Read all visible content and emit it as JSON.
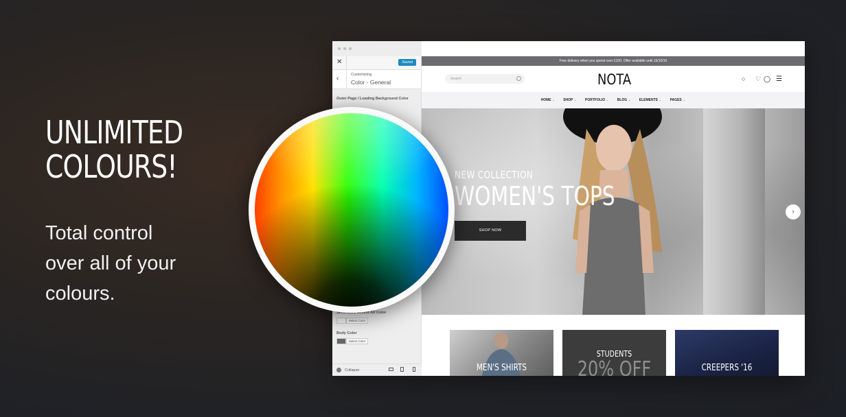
{
  "headline": {
    "line1": "UNLIMITED",
    "line2": "COLOURS!"
  },
  "subtext": {
    "line1": "Total control",
    "line2": "over all of your",
    "line3": "colours."
  },
  "customizer": {
    "close_icon": "close-icon",
    "saved_label": "Saved",
    "back_icon": "chevron-left-icon",
    "section_sup": "Customizing",
    "section_title": "Color - General",
    "options": [
      {
        "label": "Outer Page / Loading Background Color"
      },
      {
        "label": "Secondary Accent Alt Color",
        "button": "Select Color",
        "swatch": "#f2f2f2"
      },
      {
        "label": "Body Color",
        "button": "Select Color",
        "swatch": "#666666"
      }
    ],
    "collapse_label": "Collapse",
    "device_icons": [
      "desktop-icon",
      "tablet-icon",
      "mobile-icon"
    ]
  },
  "site": {
    "promo": "Free delivery when you spend over £100. Offer available until 16/10/16",
    "search_placeholder": "Search",
    "logo": "NOTA",
    "nav": [
      "HOME",
      "SHOP",
      "PORTFOLIO",
      "BLOG",
      "ELEMENTS",
      "PAGES"
    ],
    "hero": {
      "kicker": "NEW COLLECTION",
      "title": "WOMEN'S TOPS",
      "button": "SHOP NOW"
    },
    "tiles": [
      {
        "label": "MEN'S SHIRTS"
      },
      {
        "label1": "STUDENTS",
        "label2": "20% OFF"
      },
      {
        "label": "CREEPERS '16"
      }
    ]
  },
  "colors": {
    "primary_button": "#1e8cbe",
    "promo_bar": "#6c6c70",
    "hero_button": "#2b2b2b"
  }
}
